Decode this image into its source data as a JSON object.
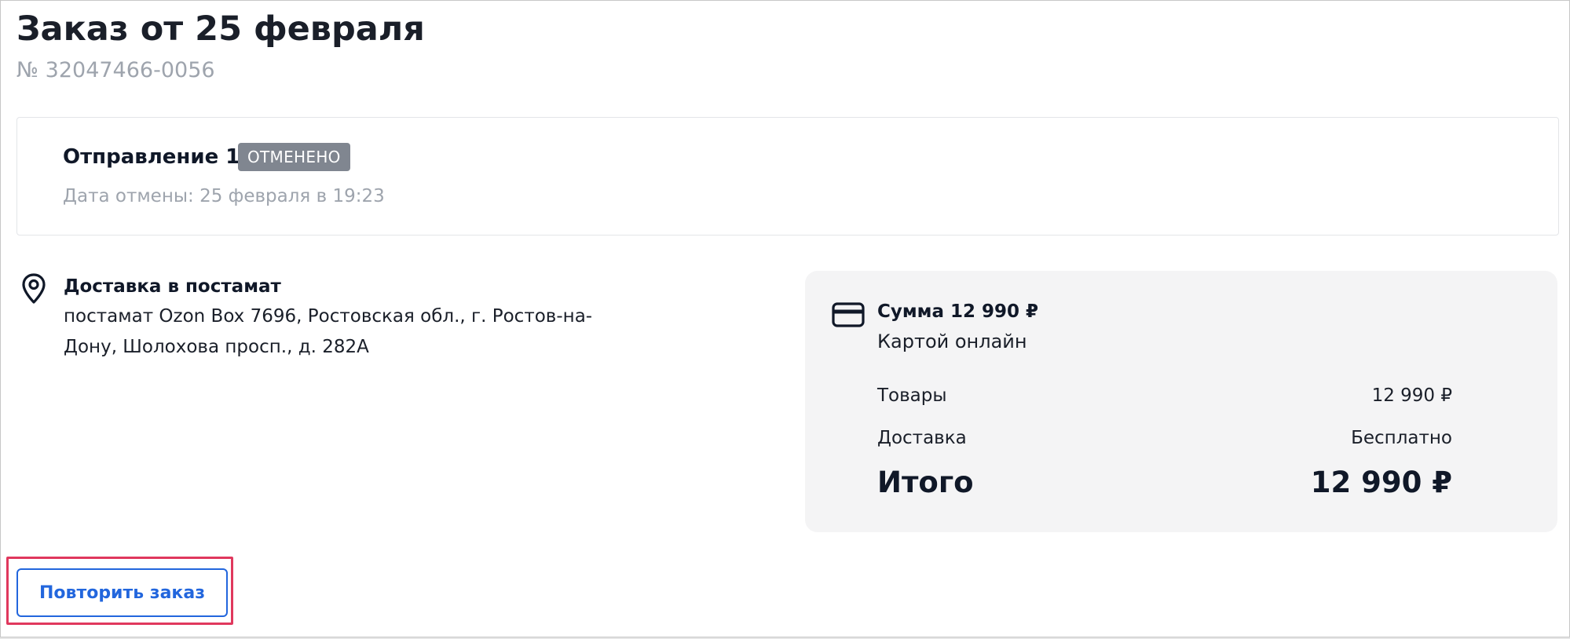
{
  "order": {
    "title": "Заказ от 25 февраля",
    "number": "№ 32047466-0056"
  },
  "shipment": {
    "title": "Отправление 1",
    "status": "ОТМЕНЕНО",
    "status_color": "#808690",
    "cancel_date": "Дата отмены: 25 февраля в 19:23"
  },
  "delivery": {
    "icon": "map-pin-icon",
    "title": "Доставка в постамат",
    "address": "постамат Ozon Box 7696, Ростовская обл., г. Ростов-на-Дону, Шолохова просп., д. 282А"
  },
  "summary": {
    "icon": "credit-card-icon",
    "sum_label": "Сумма 12 990 ₽",
    "payment_method": "Картой онлайн",
    "goods_label": "Товары",
    "goods_value": "12 990 ₽",
    "delivery_label": "Доставка",
    "delivery_value": "Бесплатно",
    "total_label": "Итого",
    "total_value": "12 990 ₽"
  },
  "actions": {
    "repeat_label": "Повторить заказ",
    "accent_color": "#2266dd",
    "highlight_color": "#e0385d"
  }
}
